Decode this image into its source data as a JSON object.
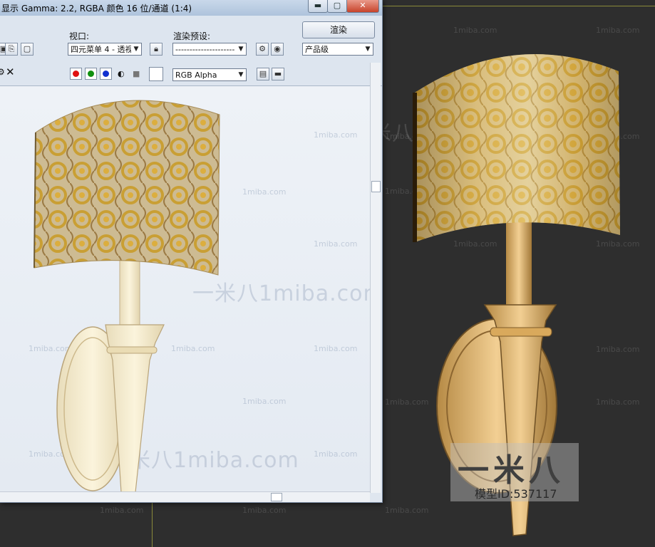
{
  "window": {
    "title": "显示 Gamma: 2.2, RGBA 颜色 16 位/通道 (1:4)",
    "controls": {
      "minimize": "▬",
      "maximize": "▢",
      "close": "✕"
    }
  },
  "toolbar": {
    "viewport_label": "视口:",
    "viewport_value": "四元菜单 4 - 透视",
    "preset_label": "渲染预设:",
    "preset_value": "---------------------",
    "render_button": "渲染",
    "quality_value": "产品级"
  },
  "toolbar2": {
    "clear_glyph": "✕",
    "channel_value": "RGB Alpha"
  },
  "overlay": {
    "logo_text": "一米八",
    "model_id": "模型ID:537117"
  },
  "watermarks": {
    "small": "1miba.com",
    "large": "一米八1miba.com"
  },
  "colors": {
    "red_channel": "#e01010",
    "green_channel": "#109010",
    "blue_channel": "#1030d0",
    "viewport_bg": "#2e2e2e",
    "frame_bg": "#dfe6ef"
  }
}
